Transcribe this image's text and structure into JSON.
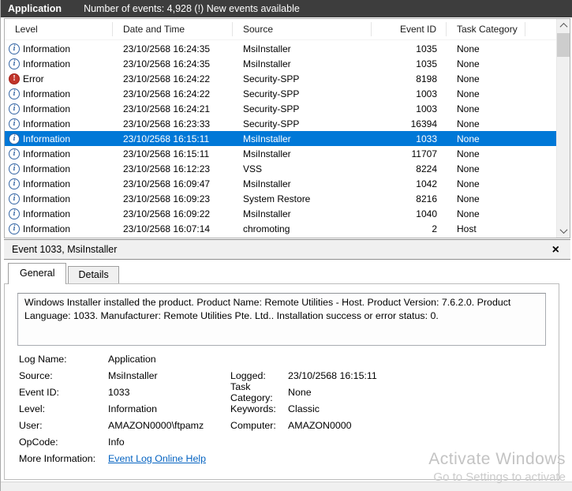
{
  "topbar": {
    "log_name": "Application",
    "events_summary": "Number of events: 4,928 (!) New events available"
  },
  "table": {
    "columns": [
      "Level",
      "Date and Time",
      "Source",
      "Event ID",
      "Task Category"
    ],
    "sorted_by": "Date and Time",
    "rows": [
      {
        "level": "Information",
        "datetime": "23/10/2568 16:24:35",
        "source": "MsiInstaller",
        "event_id": "1035",
        "task_category": "None",
        "selected": false
      },
      {
        "level": "Information",
        "datetime": "23/10/2568 16:24:35",
        "source": "MsiInstaller",
        "event_id": "1035",
        "task_category": "None",
        "selected": false
      },
      {
        "level": "Error",
        "datetime": "23/10/2568 16:24:22",
        "source": "Security-SPP",
        "event_id": "8198",
        "task_category": "None",
        "selected": false
      },
      {
        "level": "Information",
        "datetime": "23/10/2568 16:24:22",
        "source": "Security-SPP",
        "event_id": "1003",
        "task_category": "None",
        "selected": false
      },
      {
        "level": "Information",
        "datetime": "23/10/2568 16:24:21",
        "source": "Security-SPP",
        "event_id": "1003",
        "task_category": "None",
        "selected": false
      },
      {
        "level": "Information",
        "datetime": "23/10/2568 16:23:33",
        "source": "Security-SPP",
        "event_id": "16394",
        "task_category": "None",
        "selected": false
      },
      {
        "level": "Information",
        "datetime": "23/10/2568 16:15:11",
        "source": "MsiInstaller",
        "event_id": "1033",
        "task_category": "None",
        "selected": true
      },
      {
        "level": "Information",
        "datetime": "23/10/2568 16:15:11",
        "source": "MsiInstaller",
        "event_id": "11707",
        "task_category": "None",
        "selected": false
      },
      {
        "level": "Information",
        "datetime": "23/10/2568 16:12:23",
        "source": "VSS",
        "event_id": "8224",
        "task_category": "None",
        "selected": false
      },
      {
        "level": "Information",
        "datetime": "23/10/2568 16:09:47",
        "source": "MsiInstaller",
        "event_id": "1042",
        "task_category": "None",
        "selected": false
      },
      {
        "level": "Information",
        "datetime": "23/10/2568 16:09:23",
        "source": "System Restore",
        "event_id": "8216",
        "task_category": "None",
        "selected": false
      },
      {
        "level": "Information",
        "datetime": "23/10/2568 16:09:22",
        "source": "MsiInstaller",
        "event_id": "1040",
        "task_category": "None",
        "selected": false
      },
      {
        "level": "Information",
        "datetime": "23/10/2568 16:07:14",
        "source": "chromoting",
        "event_id": "2",
        "task_category": "Host",
        "selected": false
      }
    ]
  },
  "preview": {
    "title": "Event 1033, MsiInstaller",
    "tabs": {
      "general": "General",
      "details": "Details"
    },
    "active_tab": "General",
    "description": "Windows Installer installed the product. Product Name: Remote Utilities - Host. Product Version: 7.6.2.0. Product Language: 1033. Manufacturer: Remote Utilities Pte. Ltd.. Installation success or error status: 0.",
    "fields": {
      "log_name_label": "Log Name:",
      "log_name": "Application",
      "source_label": "Source:",
      "source": "MsiInstaller",
      "event_id_label": "Event ID:",
      "event_id": "1033",
      "level_label": "Level:",
      "level": "Information",
      "user_label": "User:",
      "user": "AMAZON0000\\ftpamz",
      "opcode_label": "OpCode:",
      "opcode": "Info",
      "more_info_label": "More Information:",
      "more_info_link": "Event Log Online Help",
      "logged_label": "Logged:",
      "logged": "23/10/2568 16:15:11",
      "task_category_label": "Task Category:",
      "task_category": "None",
      "keywords_label": "Keywords:",
      "keywords": "Classic",
      "computer_label": "Computer:",
      "computer": "AMAZON0000"
    }
  },
  "watermark": {
    "line1": "Activate Windows",
    "line2": "Go to Settings to activate"
  },
  "colors": {
    "selection_blue": "#0078d7",
    "topbar_bg": "#3d3d3d",
    "error_red": "#c1352b",
    "info_blue": "#3465a4",
    "link_blue": "#0563c1",
    "pane_gray": "#f0f0f0",
    "watermark_gray": "#c3c3c3"
  },
  "icons": {
    "information": "information-icon",
    "error": "error-icon",
    "sort_ascending": "chevron-up-icon",
    "close": "close-icon"
  }
}
